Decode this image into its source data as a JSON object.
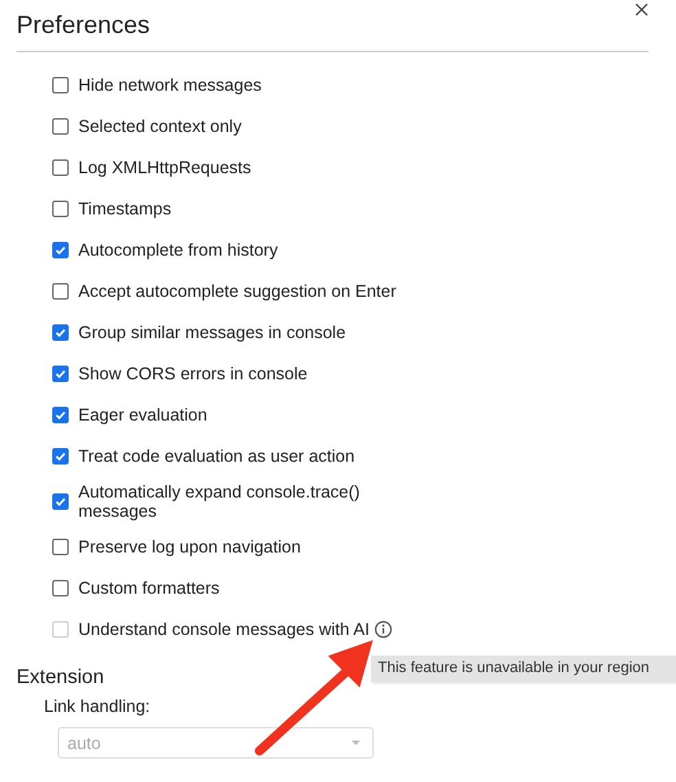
{
  "dialog": {
    "title": "Preferences"
  },
  "console_settings": [
    {
      "label": "Hide network messages",
      "checked": false,
      "disabled": false
    },
    {
      "label": "Selected context only",
      "checked": false,
      "disabled": false
    },
    {
      "label": "Log XMLHttpRequests",
      "checked": false,
      "disabled": false
    },
    {
      "label": "Timestamps",
      "checked": false,
      "disabled": false
    },
    {
      "label": "Autocomplete from history",
      "checked": true,
      "disabled": false
    },
    {
      "label": "Accept autocomplete suggestion on Enter",
      "checked": false,
      "disabled": false
    },
    {
      "label": "Group similar messages in console",
      "checked": true,
      "disabled": false
    },
    {
      "label": "Show CORS errors in console",
      "checked": true,
      "disabled": false
    },
    {
      "label": "Eager evaluation",
      "checked": true,
      "disabled": false
    },
    {
      "label": "Treat code evaluation as user action",
      "checked": true,
      "disabled": false
    },
    {
      "label": "Automatically expand console.trace() messages",
      "checked": true,
      "disabled": false
    },
    {
      "label": "Preserve log upon navigation",
      "checked": false,
      "disabled": false
    },
    {
      "label": "Custom formatters",
      "checked": false,
      "disabled": false
    },
    {
      "label": "Understand console messages with AI",
      "checked": false,
      "disabled": true,
      "info": true
    }
  ],
  "tooltip": {
    "text": "This feature is unavailable in your region"
  },
  "extension": {
    "heading": "Extension",
    "link_handling": {
      "label": "Link handling:",
      "value": "auto",
      "disabled": true
    }
  },
  "annotation": {
    "kind": "arrow"
  }
}
